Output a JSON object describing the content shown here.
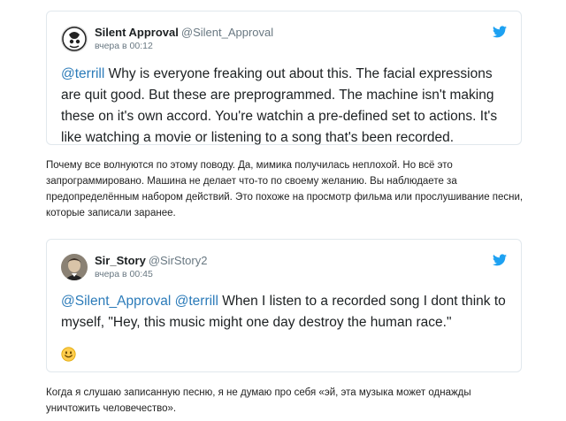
{
  "tweets": [
    {
      "display_name": "Silent Approval",
      "handle": "@Silent_Approval",
      "time": "вчера в 00:12",
      "mentions": [
        "@terrill"
      ],
      "text": " Why is everyone freaking out about this. The facial expressions are quit good. But these are preprogrammed. The machine isn't making these on it's own accord. You're watchin a pre-defined set to actions. It's like watching a movie or listening to a song that's been recorded.",
      "icons": [
        "avatar",
        "twitter-bird-icon"
      ]
    },
    {
      "display_name": "Sir_Story",
      "handle": "@SirStory2",
      "time": "вчера в 00:45",
      "mentions": [
        "@Silent_Approval",
        "@terrill"
      ],
      "text": " When I listen to a recorded song I dont think to myself, \"Hey, this music might one day destroy the human race.\"",
      "icons": [
        "avatar",
        "twitter-bird-icon",
        "smiley-emoji-icon"
      ]
    }
  ],
  "translations": [
    "Почему все волнуются по этому поводу. Да, мимика получилась неплохой. Но всё это запрограммировано. Машина не делает что-то по своему желанию. Вы наблюдаете за предопределённым набором действий. Это похоже на просмотр фильма или прослушивание песни, которые записали заранее.",
    "Когда я слушаю записанную песню, я не думаю про себя «эй, эта музыка может однажды уничтожить человечество»."
  ],
  "colors": {
    "mention": "#2b7bb9",
    "twitter_blue": "#1da1f2",
    "border": "#e1e8ed",
    "muted": "#697882"
  }
}
